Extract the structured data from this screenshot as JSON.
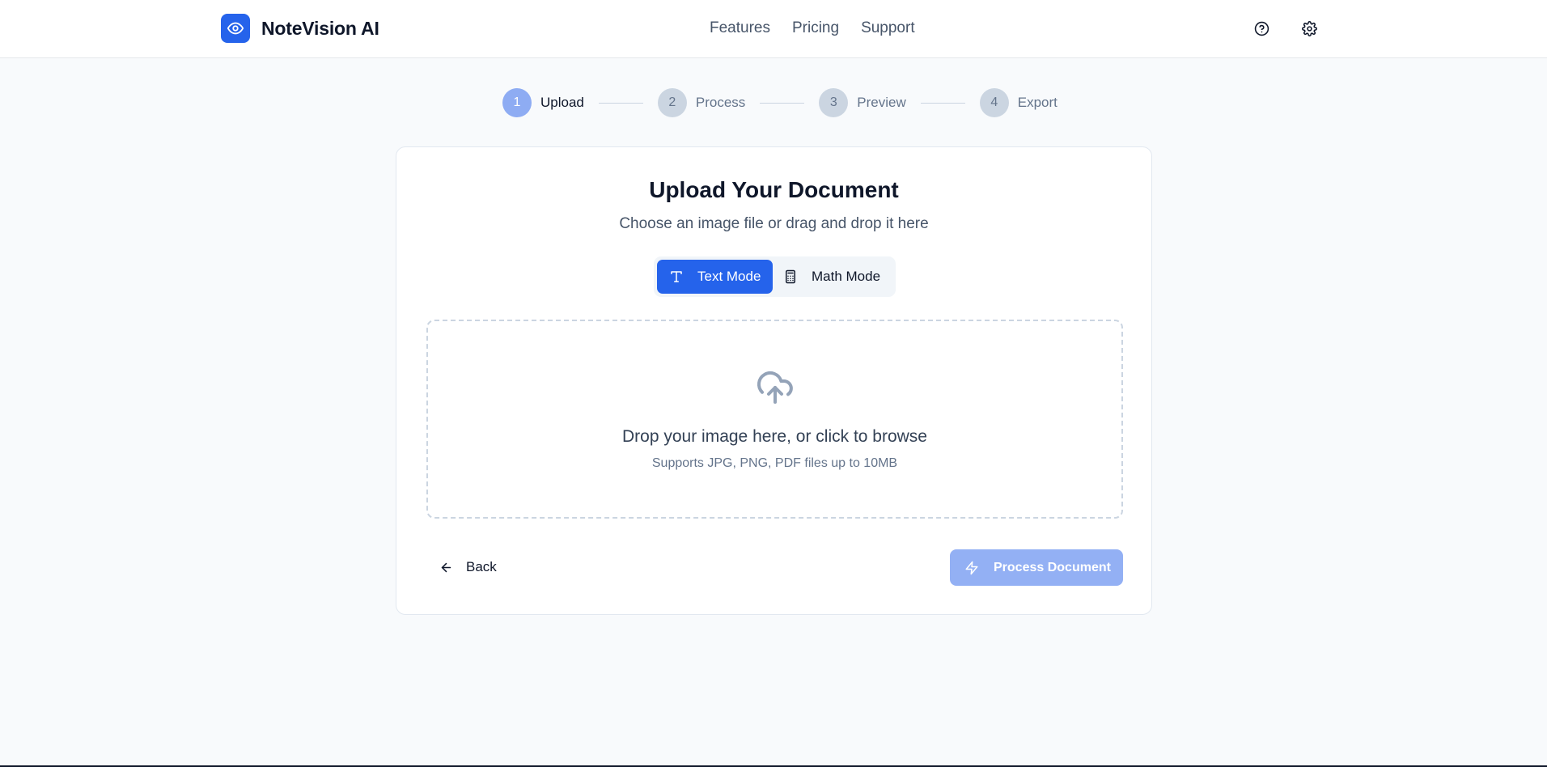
{
  "header": {
    "brand": "NoteVision AI",
    "nav": [
      "Features",
      "Pricing",
      "Support"
    ],
    "icons": [
      "help-circle-icon",
      "gear-icon"
    ]
  },
  "steps": [
    {
      "number": "1",
      "label": "Upload",
      "active": true
    },
    {
      "number": "2",
      "label": "Process",
      "active": false
    },
    {
      "number": "3",
      "label": "Preview",
      "active": false
    },
    {
      "number": "4",
      "label": "Export",
      "active": false
    }
  ],
  "card": {
    "title": "Upload Your Document",
    "subtitle": "Choose an image file or drag and drop it here",
    "modes": {
      "text": "Text Mode",
      "math": "Math Mode",
      "selected": "Text Mode"
    },
    "dropzone": {
      "main": "Drop your image here, or click to browse",
      "sub": "Supports JPG, PNG, PDF files up to 10MB"
    },
    "back_label": "Back",
    "process_label": "Process Document"
  },
  "colors": {
    "primary": "#2563eb",
    "primary_disabled": "#93b0f4",
    "step_active": "#8eacf3"
  }
}
